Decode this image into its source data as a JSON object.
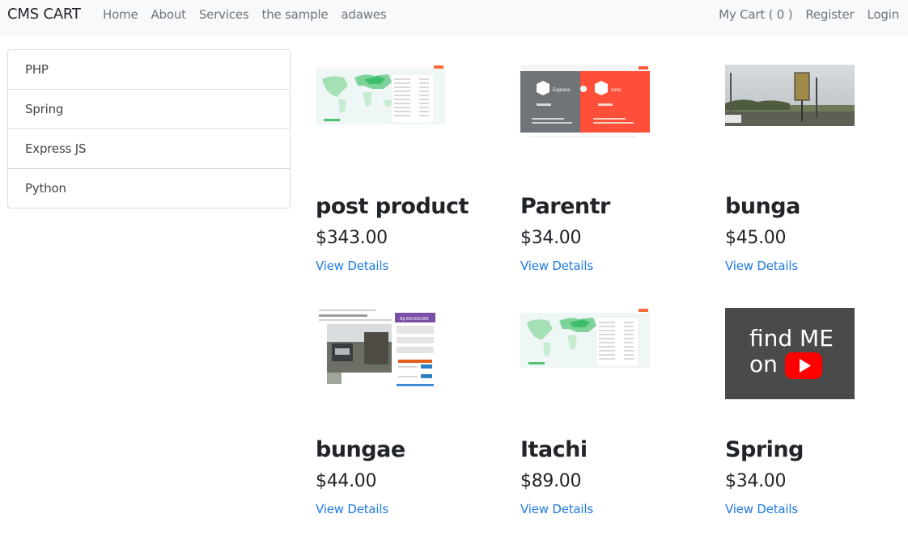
{
  "navbar": {
    "brand": "CMS CART",
    "links": [
      "Home",
      "About",
      "Services",
      "the sample",
      "adawes"
    ],
    "right_links": [
      "My Cart ( 0 )",
      "Register",
      "Login"
    ]
  },
  "sidebar": {
    "items": [
      "PHP",
      "Spring",
      "Express JS",
      "Python"
    ]
  },
  "products": [
    {
      "title": "post product",
      "price": "$343.00",
      "link": "View Details",
      "image": "map-screenshot"
    },
    {
      "title": "Parentr",
      "price": "$34.00",
      "link": "View Details",
      "image": "express-vs-ionic-screenshot"
    },
    {
      "title": "bunga",
      "price": "$45.00",
      "link": "View Details",
      "image": "street-photo"
    },
    {
      "title": "bungae",
      "price": "$44.00",
      "link": "View Details",
      "image": "listing-screenshot"
    },
    {
      "title": "Itachi",
      "price": "$89.00",
      "link": "View Details",
      "image": "map-screenshot"
    },
    {
      "title": "Spring",
      "price": "$34.00",
      "link": "View Details",
      "image": "youtube-banner"
    }
  ],
  "banner_text": {
    "line1": "find ME",
    "line2": "on"
  },
  "colors": {
    "link": "#1f7ae0",
    "navbar_bg": "#f8f9fa",
    "youtube_red": "#ff0000",
    "banner_bg": "#4a4a4a"
  }
}
